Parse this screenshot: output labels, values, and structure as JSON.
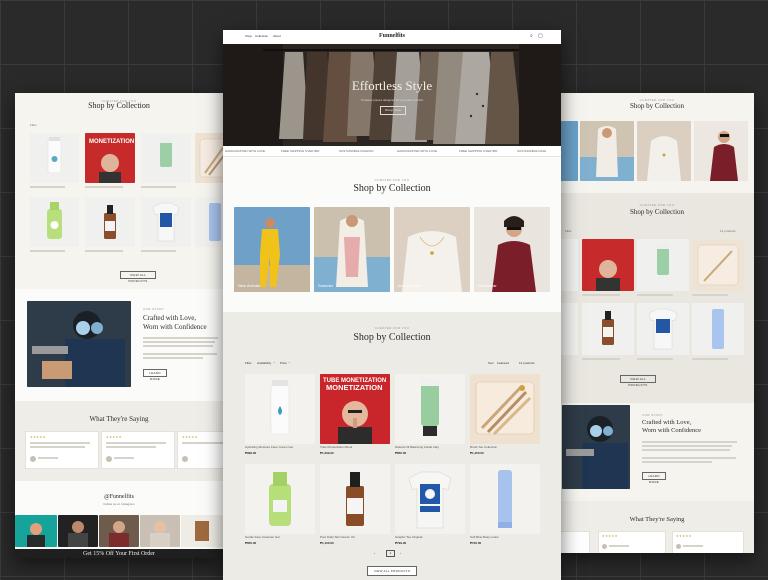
{
  "brand": {
    "name": "Funnelfits"
  },
  "nav": {
    "items": [
      "Shop",
      "Collection",
      "About"
    ]
  },
  "hero": {
    "title": "Effortless Style",
    "subtitle": "Timeless pieces designed for everyday comfort",
    "cta": "Shop Now"
  },
  "marquee": {
    "items": [
      "HANDCRAFTED WITH LOVE",
      "FREE SHIPPING OVER $50",
      "SUSTAINABLE FASHION",
      "HANDCRAFTED WITH LOVE",
      "FREE SHIPPING OVER $50",
      "SUSTAINABLE FASH"
    ]
  },
  "collections_section": {
    "eyebrow": "CURATED FOR YOU",
    "title": "Shop by Collection",
    "tiles": [
      {
        "label": "New Arrivals"
      },
      {
        "label": "Summer"
      },
      {
        "label": "Accessories"
      },
      {
        "label": "Outerwear"
      }
    ]
  },
  "products_section": {
    "eyebrow": "CURATED FOR YOU",
    "title": "Shop by Collection",
    "filters": [
      "Filter",
      "Availability",
      "Price"
    ],
    "sort": {
      "label": "Sort",
      "value": "Featured"
    },
    "count": "12 products",
    "products": [
      {
        "name": "Hydrating Moisture Face Cream Gel",
        "price": "₱999.00"
      },
      {
        "name": "Tube Monetization Book",
        "price": "₱1,299.00"
      },
      {
        "name": "Natural Oil Balancing Facial Clay",
        "price": "₱850.00"
      },
      {
        "name": "Brush Set Collection",
        "price": "₱1,450.00"
      },
      {
        "name": "Gentle Face Cleanser Gel",
        "price": "₱650.00"
      },
      {
        "name": "Pure Daily Skin Serum Oil",
        "price": "₱1,100.00"
      },
      {
        "name": "Graphic Tee Original",
        "price": "₱799.00"
      },
      {
        "name": "Soft Blue Body Lotion",
        "price": "₱720.00"
      }
    ],
    "pagination": {
      "prev": "‹",
      "current": "1",
      "next": "›"
    },
    "view_all": "VIEW ALL PRODUCTS"
  },
  "story": {
    "eyebrow": "OUR STORY",
    "title_line1": "Crafted with Love,",
    "title_line2": "Worn with Confidence",
    "cta": "LEARN MORE"
  },
  "testimonials": {
    "title": "What They're Saying"
  },
  "instagram": {
    "handle": "@Funnelfits",
    "sub": "Follow us on Instagram"
  },
  "footer_promo": {
    "text": "Get 15% Off Your First Order"
  },
  "colors": {
    "accent": "#c9a53d",
    "ink": "#2b2b2b",
    "panel": "#f5f4ef",
    "band": "#e9e7e0"
  }
}
